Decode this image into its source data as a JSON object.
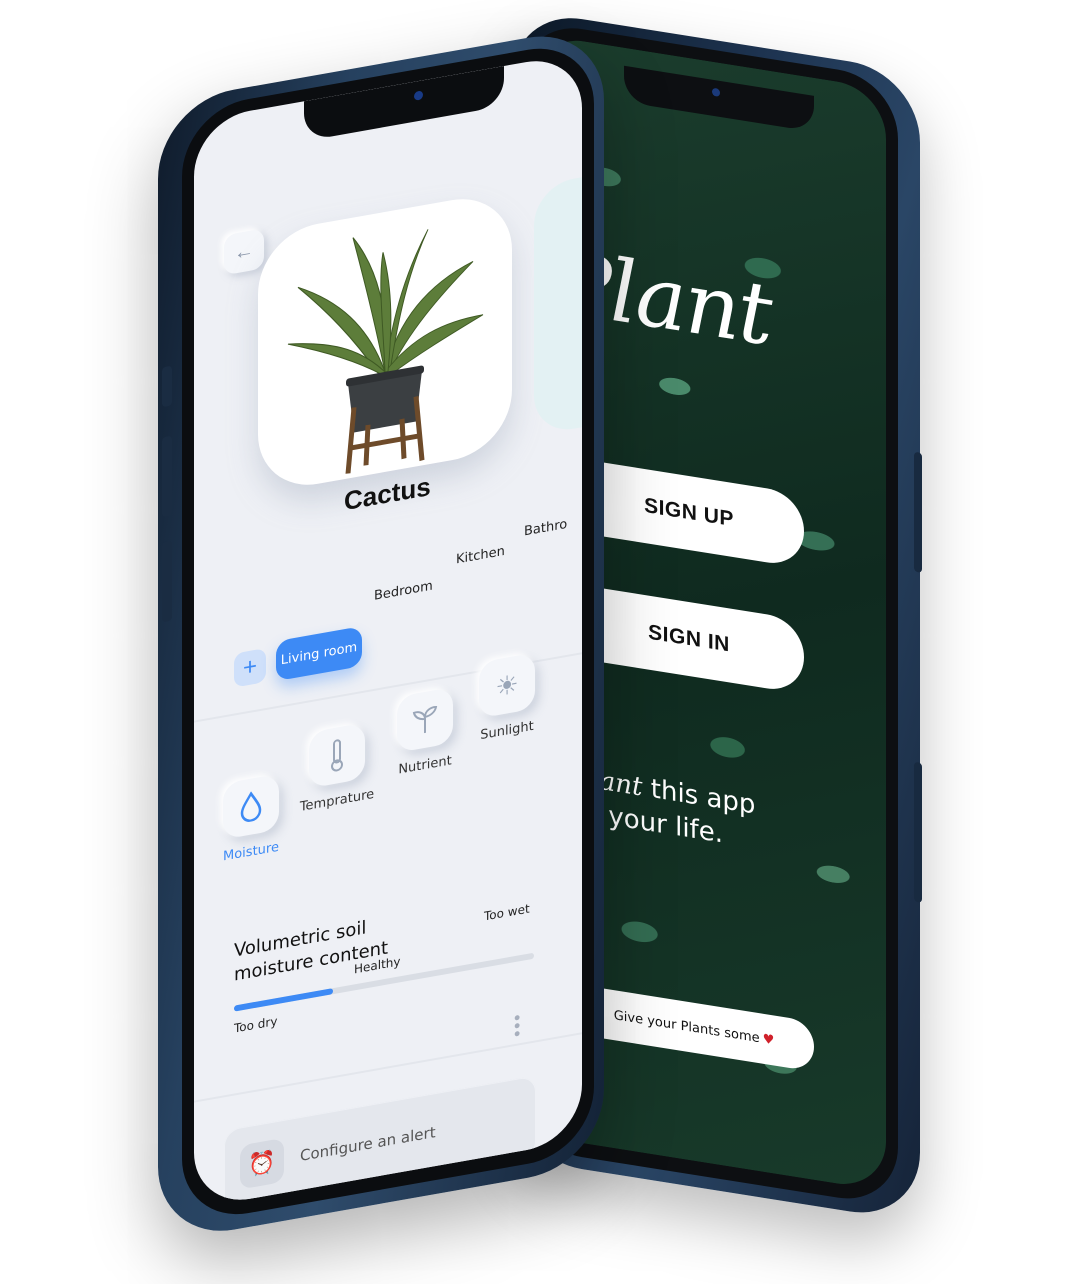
{
  "signin_screen": {
    "logo": "Plant",
    "sign_up_label": "SIGN UP",
    "sign_in_label": "SIGN IN",
    "tagline_script": "Plant",
    "tagline_rest_1": "this app",
    "tagline_rest_2": "to your life.",
    "footer_text": "Give your Plants some",
    "heart_icon": "heart-icon",
    "colors": {
      "background": "#1b3d2d",
      "button": "#ffffff"
    }
  },
  "plant_screen": {
    "back_icon": "arrow-left-icon",
    "plant_name": "Cactus",
    "add_icon": "plus-icon",
    "rooms": [
      "Living room",
      "Bedroom",
      "Kitchen",
      "Bathro"
    ],
    "active_room": "Living room",
    "metrics": [
      {
        "label": "Moisture",
        "icon": "droplet-icon",
        "active": true
      },
      {
        "label": "Temprature",
        "icon": "thermometer-icon",
        "active": false
      },
      {
        "label": "Nutrient",
        "icon": "sprout-icon",
        "active": false
      },
      {
        "label": "Sunlight",
        "icon": "sun-icon",
        "active": false
      }
    ],
    "moisture": {
      "title": "Volumetric soil moisture content",
      "levels": [
        "Too dry",
        "Healthy",
        "Too wet"
      ],
      "level_fraction": 0.33
    },
    "alert_label": "Configure an alert",
    "alert_icon": "alarm-clock-icon",
    "more_icon": "more-vertical-icon",
    "colors": {
      "accent": "#3d8af5",
      "background": "#eef0f5"
    }
  }
}
